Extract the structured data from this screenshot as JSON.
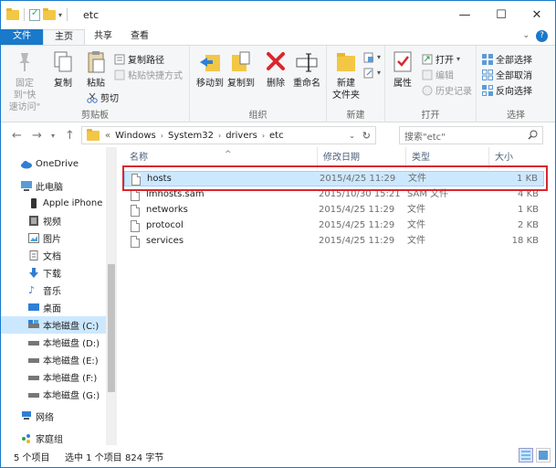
{
  "window": {
    "title": "etc",
    "minimize": "—",
    "maximize": "☐",
    "close": "✕"
  },
  "tabs": {
    "file": "文件",
    "home": "主页",
    "share": "共享",
    "view": "查看"
  },
  "ribbon": {
    "clipboard": {
      "label": "剪贴板",
      "pin": "固定到\"快\n速访问\"",
      "copy": "复制",
      "paste": "粘贴",
      "copy_path": "复制路径",
      "paste_shortcut": "粘贴快捷方式",
      "cut": "剪切"
    },
    "organize": {
      "label": "组织",
      "move_to": "移动到",
      "copy_to": "复制到",
      "delete": "删除",
      "rename": "重命名"
    },
    "new": {
      "label": "新建",
      "new_folder": "新建\n文件夹"
    },
    "open": {
      "label": "打开",
      "properties": "属性",
      "open": "打开",
      "edit": "编辑",
      "history": "历史记录"
    },
    "select": {
      "label": "选择",
      "select_all": "全部选择",
      "select_none": "全部取消",
      "invert": "反向选择"
    }
  },
  "address": {
    "prefix": "«",
    "path": [
      "Windows",
      "System32",
      "drivers",
      "etc"
    ],
    "search_placeholder": "搜索\"etc\""
  },
  "nav": [
    {
      "label": "OneDrive",
      "icon": "cloud-icon"
    },
    {
      "label": "此电脑",
      "icon": "computer-icon"
    },
    {
      "label": "Apple iPhone",
      "icon": "phone-icon"
    },
    {
      "label": "视频",
      "icon": "video-icon"
    },
    {
      "label": "图片",
      "icon": "picture-icon"
    },
    {
      "label": "文档",
      "icon": "document-icon"
    },
    {
      "label": "下载",
      "icon": "download-icon"
    },
    {
      "label": "音乐",
      "icon": "music-icon"
    },
    {
      "label": "桌面",
      "icon": "desktop-icon"
    },
    {
      "label": "本地磁盘 (C:)",
      "icon": "drive-icon",
      "selected": true
    },
    {
      "label": "本地磁盘 (D:)",
      "icon": "drive-icon"
    },
    {
      "label": "本地磁盘 (E:)",
      "icon": "drive-icon"
    },
    {
      "label": "本地磁盘 (F:)",
      "icon": "drive-icon"
    },
    {
      "label": "本地磁盘 (G:)",
      "icon": "drive-icon"
    },
    {
      "label": "网络",
      "icon": "network-icon"
    },
    {
      "label": "家庭组",
      "icon": "homegroup-icon"
    }
  ],
  "columns": {
    "name": "名称",
    "date": "修改日期",
    "type": "类型",
    "size": "大小"
  },
  "files": [
    {
      "name": "hosts",
      "date": "2015/4/25 11:29",
      "type": "文件",
      "size": "1 KB",
      "selected": true
    },
    {
      "name": "lmhosts.sam",
      "date": "2015/10/30 15:21",
      "type": "SAM 文件",
      "size": "4 KB"
    },
    {
      "name": "networks",
      "date": "2015/4/25 11:29",
      "type": "文件",
      "size": "1 KB"
    },
    {
      "name": "protocol",
      "date": "2015/4/25 11:29",
      "type": "文件",
      "size": "2 KB"
    },
    {
      "name": "services",
      "date": "2015/4/25 11:29",
      "type": "文件",
      "size": "18 KB"
    }
  ],
  "status": {
    "count": "5 个项目",
    "selected": "选中 1 个项目",
    "size": "824 字节"
  },
  "colors": {
    "accent": "#1979ca",
    "selection": "#cce8ff",
    "highlight_box": "#d9272e",
    "folder": "#f3c746"
  }
}
